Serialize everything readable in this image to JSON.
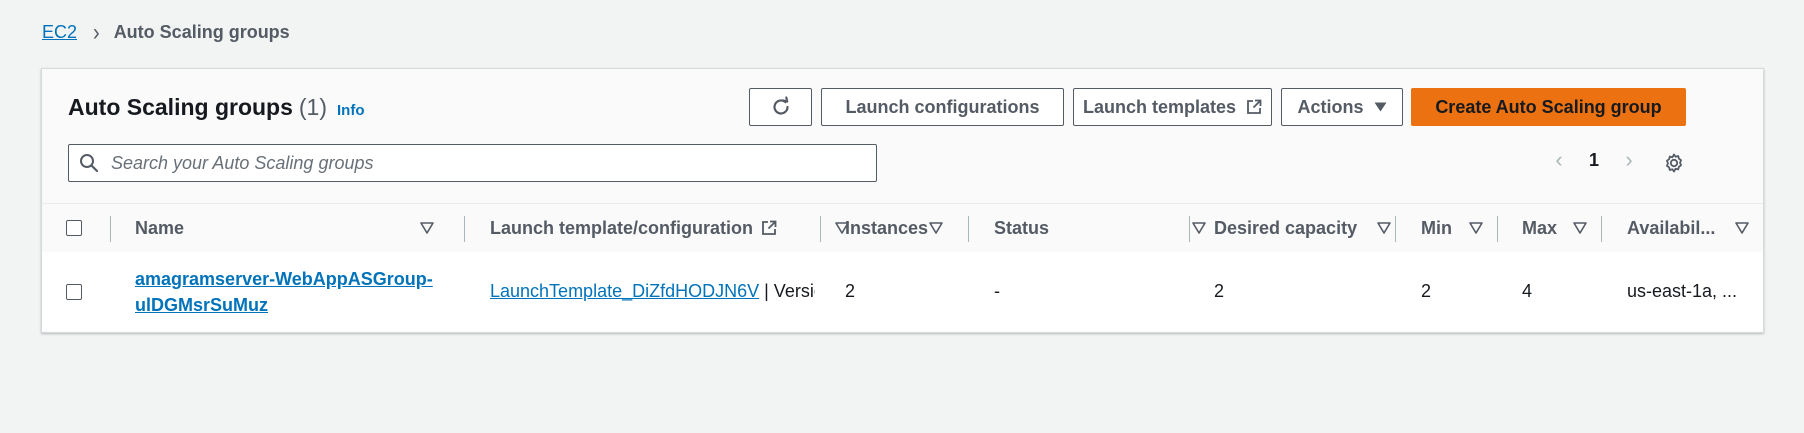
{
  "breadcrumb": {
    "root": "EC2",
    "current": "Auto Scaling groups"
  },
  "panel": {
    "title": "Auto Scaling groups",
    "count": "(1)",
    "info_label": "Info",
    "buttons": {
      "launch_configurations": "Launch configurations",
      "launch_templates": "Launch templates",
      "actions": "Actions",
      "create": "Create Auto Scaling group"
    },
    "search_placeholder": "Search your Auto Scaling groups",
    "page_number": "1"
  },
  "table": {
    "columns": [
      "Name",
      "Launch template/configuration",
      "Instances",
      "Status",
      "Desired capacity",
      "Min",
      "Max",
      "Availabil..."
    ],
    "rows": [
      {
        "name_line1": "amagramserver-WebAppASGroup-",
        "name_line2": "ulDGMsrSuMuz",
        "launch_template_link": "LaunchTemplate_DiZfdHODJN6V",
        "launch_template_suffix": " | Version",
        "instances": "2",
        "status": "-",
        "desired_capacity": "2",
        "min": "2",
        "max": "4",
        "availability": "us-east-1a, ..."
      }
    ]
  },
  "colors": {
    "accent": "#0073bb",
    "primary_button": "#ec7211",
    "background": "#f2f3f3"
  }
}
